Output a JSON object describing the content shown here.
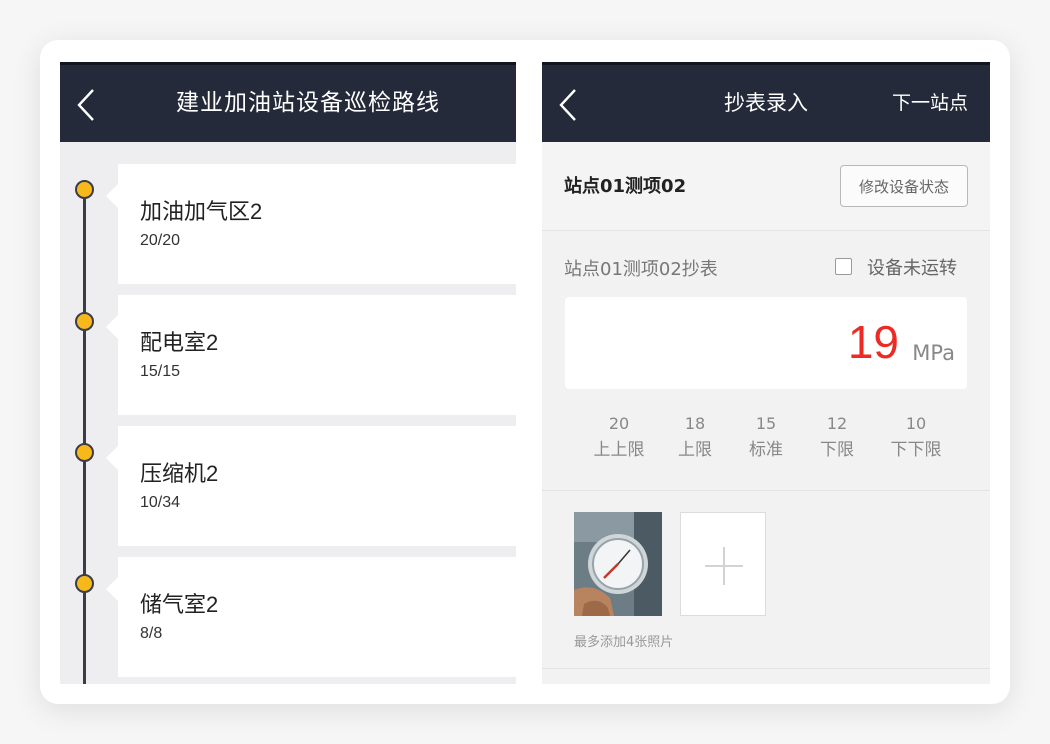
{
  "left": {
    "title": "建业加油站设备巡检路线",
    "stations": [
      {
        "name": "加油加气区2",
        "progress": "20/20"
      },
      {
        "name": "配电室2",
        "progress": "15/15"
      },
      {
        "name": "压缩机2",
        "progress": "10/34"
      },
      {
        "name": "储气室2",
        "progress": "8/8"
      }
    ]
  },
  "right": {
    "title": "抄表录入",
    "next_label": "下一站点",
    "item_title": "站点01测项02",
    "modify_label": "修改设备状态",
    "reading_label": "站点01测项02抄表",
    "not_running_label": "设备未运转",
    "value": "19",
    "unit": "MPa",
    "limits": [
      {
        "value": "20",
        "label": "上上限"
      },
      {
        "value": "18",
        "label": "上限"
      },
      {
        "value": "15",
        "label": "标准"
      },
      {
        "value": "12",
        "label": "下限"
      },
      {
        "value": "10",
        "label": "下下限"
      }
    ],
    "photo_hint": "最多添加4张照片"
  },
  "colors": {
    "header_bg": "#252a3a",
    "accent_orange": "#f5a10f",
    "dot_yellow": "#f7b81a",
    "value_red": "#ee2a24"
  },
  "icons": {
    "back": "back-arrow-icon",
    "chevron": "chevron-right-icon",
    "add": "plus-icon"
  }
}
